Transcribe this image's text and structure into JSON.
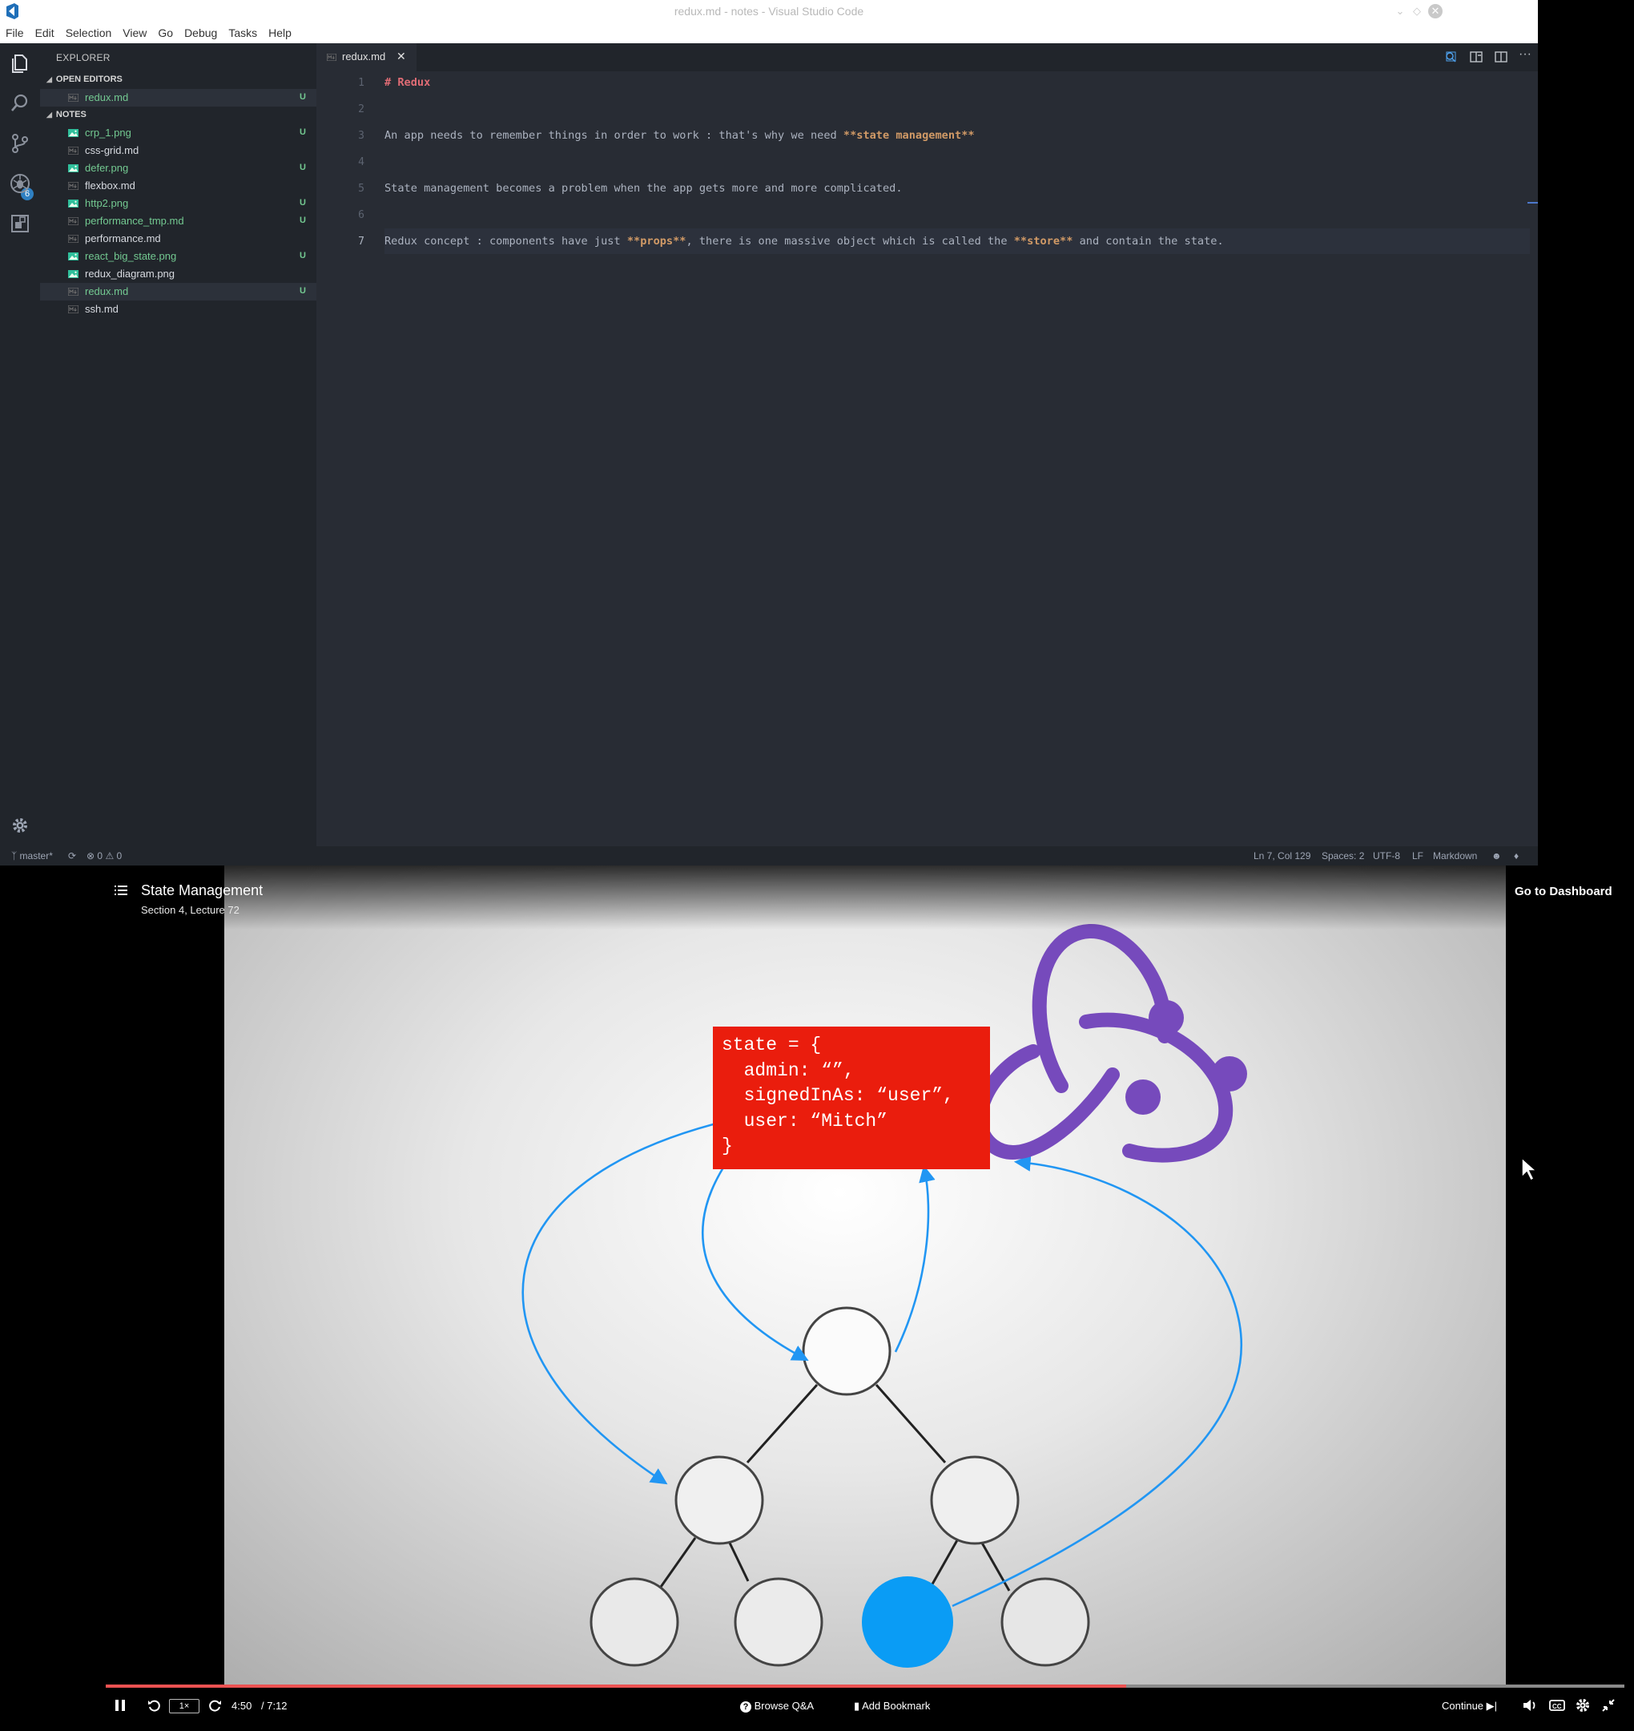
{
  "window": {
    "title": "redux.md - notes - Visual Studio Code"
  },
  "menu": [
    "File",
    "Edit",
    "Selection",
    "View",
    "Go",
    "Debug",
    "Tasks",
    "Help"
  ],
  "activity_bar": {
    "scm_badge": "6"
  },
  "explorer": {
    "title": "EXPLORER",
    "open_editors": {
      "label": "OPEN EDITORS",
      "files": [
        {
          "name": "redux.md",
          "status": "U"
        }
      ]
    },
    "notes": {
      "label": "NOTES",
      "files": [
        {
          "name": "crp_1.png",
          "status": "U",
          "type": "image"
        },
        {
          "name": "css-grid.md",
          "status": "",
          "type": "md"
        },
        {
          "name": "defer.png",
          "status": "U",
          "type": "image"
        },
        {
          "name": "flexbox.md",
          "status": "",
          "type": "md"
        },
        {
          "name": "http2.png",
          "status": "U",
          "type": "image"
        },
        {
          "name": "performance_tmp.md",
          "status": "U",
          "type": "md"
        },
        {
          "name": "performance.md",
          "status": "",
          "type": "md"
        },
        {
          "name": "react_big_state.png",
          "status": "U",
          "type": "image"
        },
        {
          "name": "redux_diagram.png",
          "status": "",
          "type": "image"
        },
        {
          "name": "redux.md",
          "status": "U",
          "type": "md"
        },
        {
          "name": "ssh.md",
          "status": "",
          "type": "md"
        }
      ]
    }
  },
  "editor": {
    "tab": "redux.md",
    "line_numbers": [
      "1",
      "2",
      "3",
      "4",
      "5",
      "6",
      "7"
    ],
    "lines": {
      "l1": "# Redux",
      "l3a": "An app needs to remember things in order to work : that's why we need ",
      "l3b": "**state management**",
      "l5": "State management becomes a problem when the app gets more and more complicated.",
      "l7a": "Redux concept : components have just ",
      "l7b": "**props**",
      "l7c": ", there is one massive object which is called the ",
      "l7d": "**store**",
      "l7e": " and contain the state."
    }
  },
  "statusbar": {
    "branch": "master*",
    "errors": "0",
    "warnings": "0",
    "position": "Ln 7, Col 129",
    "spaces": "Spaces: 2",
    "encoding": "UTF-8",
    "eol": "LF",
    "language": "Markdown"
  },
  "player": {
    "title": "State Management",
    "subtitle": "Section 4, Lecture 72",
    "dashboard": "Go to Dashboard",
    "speed": "1×",
    "current_time": "4:50",
    "total_time": "/ 7:12",
    "progress_fraction": 0.672,
    "browse_qa": "Browse Q&A",
    "bookmark": "Add Bookmark",
    "continue": "Continue",
    "slide_code": "state = {\n  admin: “”,\n  signedInAs: “user”,\n  user: “Mitch”\n}"
  },
  "colors": {
    "accent_green": "#73c991",
    "progress_red": "#ec5252",
    "state_box_red": "#ea1d0d",
    "redux_purple": "#764abc",
    "arrow_blue": "#2196f3",
    "active_node_blue": "#0a9cf5"
  }
}
